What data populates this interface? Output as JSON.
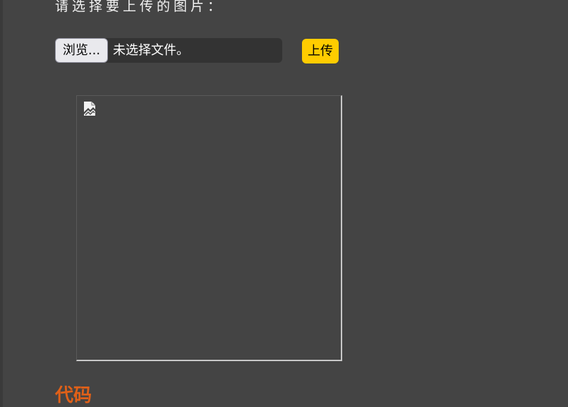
{
  "form": {
    "prompt": "请选择要上传的图片：",
    "browse_label": "浏览...",
    "file_status": "未选择文件。",
    "upload_label": "上传"
  },
  "preview": {
    "icon": "broken-image-icon"
  },
  "section": {
    "heading": "代码"
  },
  "colors": {
    "background": "#444444",
    "accent": "#ffcc00",
    "heading": "#e06018"
  }
}
